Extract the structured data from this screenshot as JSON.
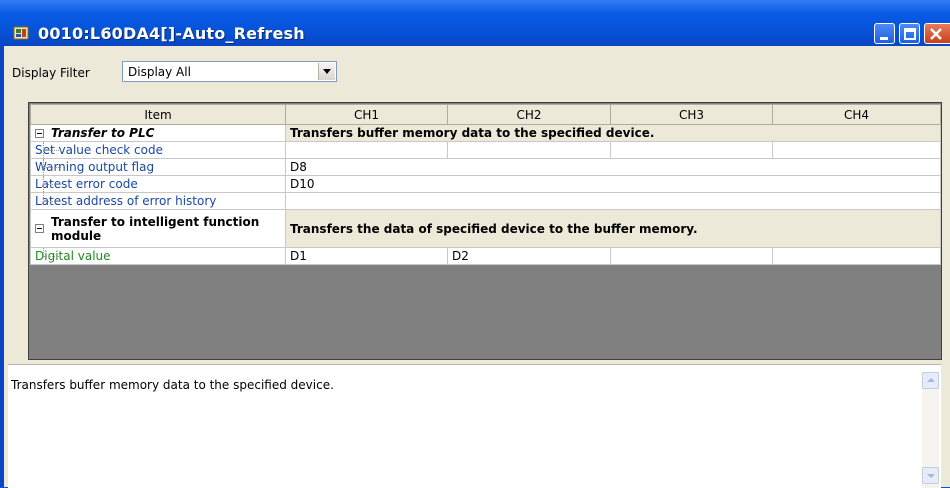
{
  "window": {
    "title": "0010:L60DA4[]-Auto_Refresh",
    "buttons": {
      "minimize": "minimize-icon",
      "maximize": "maximize-icon",
      "close": "close-icon"
    }
  },
  "filter": {
    "label": "Display Filter",
    "value": "Display All"
  },
  "grid": {
    "headers": [
      "Item",
      "CH1",
      "CH2",
      "CH3",
      "CH4"
    ],
    "rows": [
      {
        "item": "Transfer to PLC",
        "group": true,
        "desc": "Transfers buffer memory data to the specified device."
      },
      {
        "item": "Set value check code",
        "ch1": "",
        "ch2": "",
        "ch3": "",
        "ch4": ""
      },
      {
        "item": "Warning output flag",
        "value": "D8"
      },
      {
        "item": "Latest error code",
        "value": "D10"
      },
      {
        "item": "Latest address of error history",
        "value": ""
      },
      {
        "item": "Transfer to intelligent function module",
        "group": true,
        "desc": "Transfers the data of specified device to the buffer memory."
      },
      {
        "item": "Digital value",
        "ch1": "D1",
        "ch2": "D2",
        "ch3": "",
        "ch4": ""
      }
    ]
  },
  "description": {
    "text": "Transfers buffer memory data to the specified device."
  },
  "colors": {
    "titlebar": "#0a52d8",
    "item_text": "#1b48a4",
    "digital_value_text": "#208820",
    "grid_empty": "#808080",
    "client_bg": "#ece9d8"
  }
}
